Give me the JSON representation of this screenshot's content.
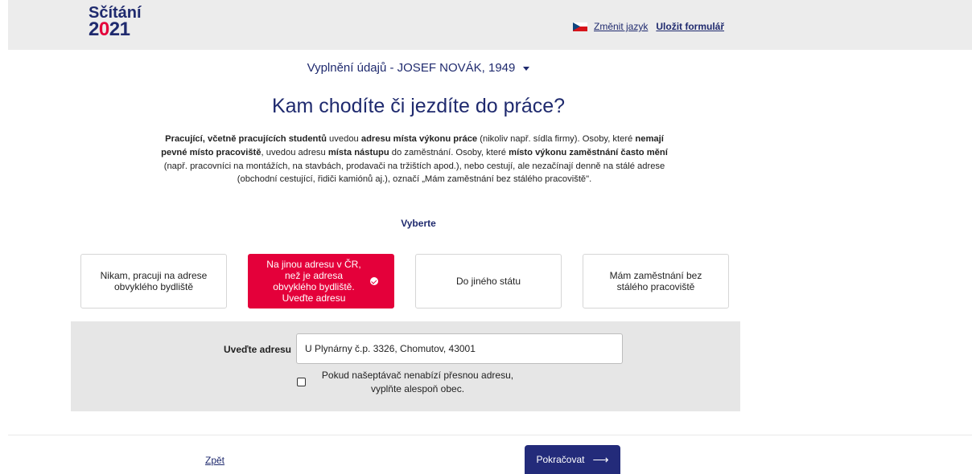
{
  "header": {
    "logo_word": "Sčítání",
    "logo_year_a": "2",
    "logo_year_b": "0",
    "logo_year_c": "21",
    "change_language": "Změnit jazyk",
    "save_form": "Uložit formulář",
    "flag_icon": "czech-flag-icon"
  },
  "person_selector": {
    "label": "Vyplnění údajů - JOSEF NOVÁK, 1949"
  },
  "question": {
    "title": "Kam chodíte či jezdíte do práce?"
  },
  "instructions": {
    "p1_b1": "Pracující, včetně pracujících studentů",
    "p1_t1": " uvedou ",
    "p1_b2": "adresu místa výkonu práce",
    "p1_t2": " (nikoliv např. sídla firmy). Osoby, které ",
    "p1_b3": "nemají pevné místo pracoviště",
    "p1_t3": ", uvedou adresu ",
    "p1_b4": "místa nástupu",
    "p1_t4": " do zaměstnání. Osoby, které ",
    "p1_b5": "místo výkonu zaměstnání často mění",
    "p1_t5": " (např. pracovníci na montážích, na stavbách, prodavači na tržištích apod.), nebo cestují, ale nezačínají denně na stálé adrese (obchodní cestující, řidiči kamiónů aj.), označí „Mám zaměstnání bez stálého pracoviště\"."
  },
  "choose_label": "Vyberte",
  "options": [
    {
      "label": "Nikam, pracuji na adrese obvyklého bydliště",
      "selected": false
    },
    {
      "label": "Na jinou adresu v ČR, než je adresa obvyklého bydliště. Uveďte adresu",
      "selected": true
    },
    {
      "label": "Do jiného státu",
      "selected": false
    },
    {
      "label": "Mám zaměstnání bez stálého pracoviště",
      "selected": false
    }
  ],
  "address": {
    "label": "Uveďte adresu",
    "value": "U Plynárny č.p. 3326, Chomutov, 43001",
    "fallback_checkbox_label": "Pokud našeptávač nenabízí přesnou adresu, vyplňte alespoň obec.",
    "fallback_checked": false
  },
  "footer": {
    "back_label": "Zpět",
    "next_label": "Pokračovat",
    "next_icon": "arrow-right-icon"
  },
  "colors": {
    "brand_navy": "#1f2a6e",
    "accent_red": "#e4003a",
    "button_navy": "#232b7a"
  }
}
